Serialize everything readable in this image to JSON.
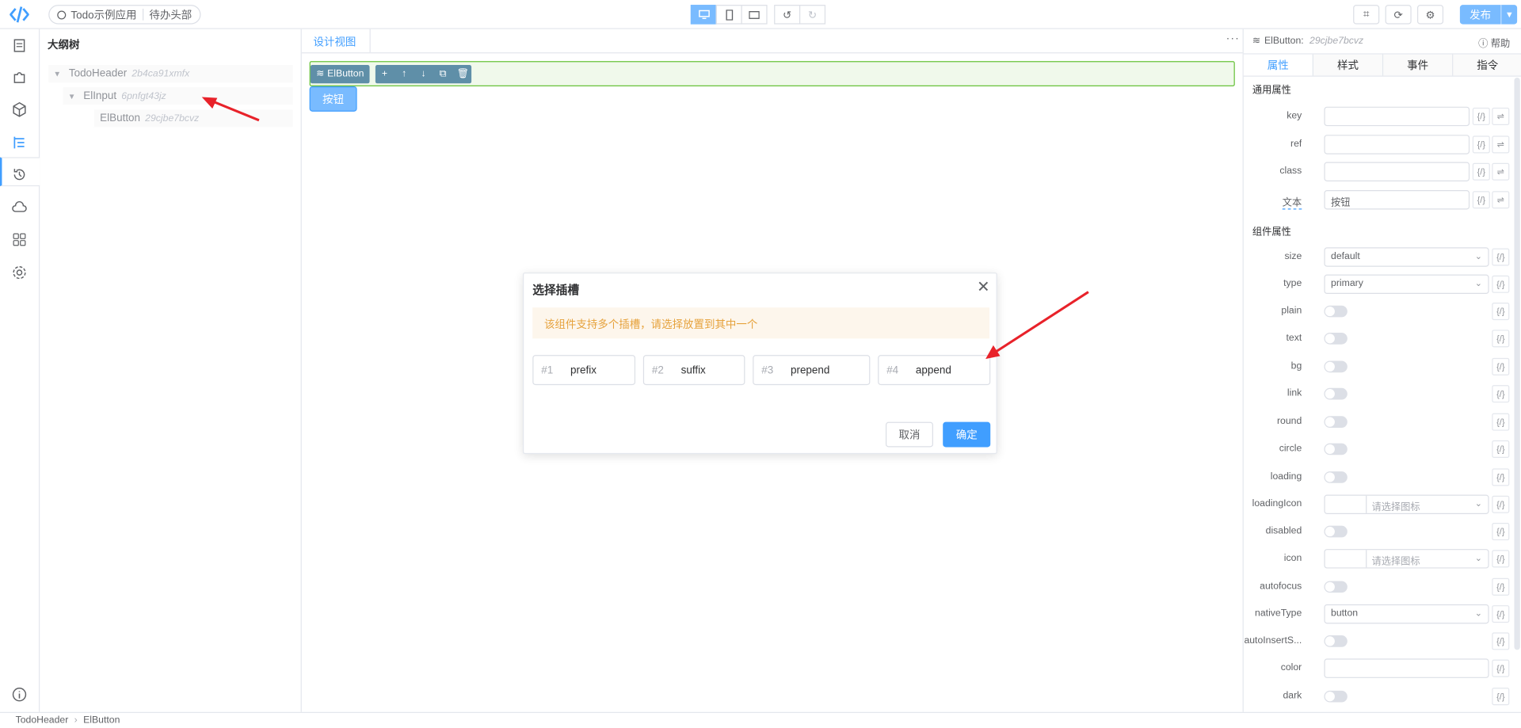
{
  "topbar": {
    "app_name": "Todo示例应用",
    "page_name": "待办头部",
    "publish_label": "发布",
    "device_icons": [
      "desktop-icon",
      "mobile-icon",
      "tablet-icon"
    ],
    "history_icons": [
      "undo-icon",
      "redo-icon"
    ],
    "tool_icons": [
      "qrcode-icon",
      "refresh-icon",
      "settings-icon"
    ]
  },
  "rail": {
    "icons": [
      "page-icon",
      "plugin-icon",
      "component-icon",
      "outline-tree-icon",
      "history-icon",
      "api-cloud-icon",
      "apps-icon",
      "settings-icon",
      "info-icon"
    ]
  },
  "tree": {
    "title": "大纲树",
    "nodes": [
      {
        "name": "TodoHeader",
        "id": "2b4ca91xmfx"
      },
      {
        "name": "ElInput",
        "id": "6pnfgt43jz"
      },
      {
        "name": "ElButton",
        "id": "29cjbe7bcvz"
      }
    ]
  },
  "design": {
    "tab_label": "设计视图",
    "more": "···",
    "selected_tag": "ElButton",
    "canvas_button": "按钮"
  },
  "props": {
    "component": "ElButton:",
    "component_id": "29cjbe7bcvz",
    "help": "帮助",
    "tabs": [
      "属性",
      "样式",
      "事件",
      "指令"
    ],
    "section_common": "通用属性",
    "section_component": "组件属性",
    "bind_label": "{/}",
    "sync_label": "⇌",
    "common": [
      {
        "label": "key",
        "value": ""
      },
      {
        "label": "ref",
        "value": ""
      },
      {
        "label": "class",
        "value": ""
      },
      {
        "label": "文本",
        "value": "按钮"
      }
    ],
    "component_props": {
      "size": {
        "label": "size",
        "value": "default"
      },
      "type": {
        "label": "type",
        "value": "primary"
      },
      "plain": {
        "label": "plain"
      },
      "text": {
        "label": "text"
      },
      "bg": {
        "label": "bg"
      },
      "link": {
        "label": "link"
      },
      "round": {
        "label": "round"
      },
      "circle": {
        "label": "circle"
      },
      "loading": {
        "label": "loading"
      },
      "loadingIcon": {
        "label": "loadingIcon",
        "placeholder": "请选择图标"
      },
      "disabled": {
        "label": "disabled"
      },
      "icon": {
        "label": "icon",
        "placeholder": "请选择图标"
      },
      "autofocus": {
        "label": "autofocus"
      },
      "nativeType": {
        "label": "nativeType",
        "value": "button"
      },
      "autoInsertSpace": {
        "label": "autoInsertS..."
      },
      "color": {
        "label": "color",
        "value": ""
      },
      "dark": {
        "label": "dark"
      }
    }
  },
  "statusbar": {
    "crumbs": [
      "TodoHeader",
      "ElButton"
    ]
  },
  "dialog": {
    "title": "选择插槽",
    "alert": "该组件支持多个插槽，请选择放置到其中一个",
    "slots": [
      {
        "no": "#1",
        "name": "prefix"
      },
      {
        "no": "#2",
        "name": "suffix"
      },
      {
        "no": "#3",
        "name": "prepend"
      },
      {
        "no": "#4",
        "name": "append"
      }
    ],
    "cancel": "取消",
    "ok": "确定"
  },
  "colors": {
    "accent": "#409eff",
    "accent_light": "#79bbff",
    "selection_green": "#67c23a",
    "warning": "#e6a23c",
    "annotation_arrow": "#e8222a"
  }
}
